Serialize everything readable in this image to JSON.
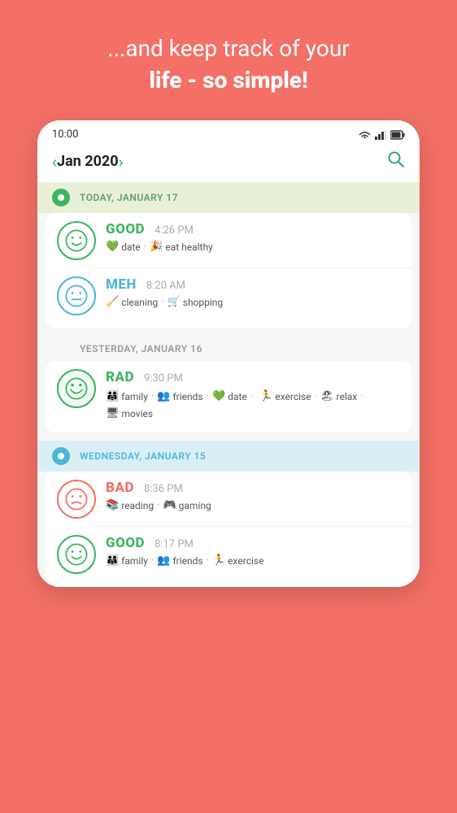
{
  "hero": {
    "text_regular": "...and keep track of your",
    "text_bold": "life - so simple!"
  },
  "status_bar": {
    "time": "10:00",
    "icons": [
      "wifi",
      "signal",
      "battery"
    ]
  },
  "nav": {
    "prev_label": "‹",
    "next_label": "›",
    "month_title": "Jan 2020",
    "search_label": "⌕"
  },
  "days": [
    {
      "id": "today",
      "dot_type": "green",
      "label": "TODAY, JANUARY 17",
      "entries": [
        {
          "mood": "good",
          "mood_label": "GOOD",
          "time": "4:26 PM",
          "tags": [
            {
              "icon": "💚",
              "label": "date"
            },
            {
              "icon": "🎉",
              "label": "eat healthy"
            }
          ]
        },
        {
          "mood": "meh",
          "mood_label": "MEH",
          "time": "8:20 AM",
          "tags": [
            {
              "icon": "🧹",
              "label": "cleaning"
            },
            {
              "icon": "🛒",
              "label": "shopping"
            }
          ]
        }
      ]
    },
    {
      "id": "yesterday",
      "dot_type": "none",
      "label": "YESTERDAY, JANUARY 16",
      "entries": [
        {
          "mood": "rad",
          "mood_label": "RAD",
          "time": "9:30 PM",
          "tags": [
            {
              "icon": "👨‍👩‍👧",
              "label": "family"
            },
            {
              "icon": "👥",
              "label": "friends"
            },
            {
              "icon": "💚",
              "label": "date"
            },
            {
              "icon": "🏃",
              "label": "exercise"
            },
            {
              "icon": "🏖",
              "label": "relax"
            },
            {
              "icon": "🖥",
              "label": "movies"
            }
          ]
        }
      ]
    },
    {
      "id": "wednesday",
      "dot_type": "blue",
      "label": "WEDNESDAY, JANUARY 15",
      "entries": [
        {
          "mood": "bad",
          "mood_label": "BAD",
          "time": "8:36 PM",
          "tags": [
            {
              "icon": "📚",
              "label": "reading"
            },
            {
              "icon": "🎮",
              "label": "gaming"
            }
          ]
        },
        {
          "mood": "good",
          "mood_label": "GOOD",
          "time": "8:17 PM",
          "tags": [
            {
              "icon": "👨‍👩‍👧",
              "label": "family"
            },
            {
              "icon": "👥",
              "label": "friends"
            },
            {
              "icon": "🏃",
              "label": "exercise"
            }
          ]
        }
      ]
    }
  ]
}
